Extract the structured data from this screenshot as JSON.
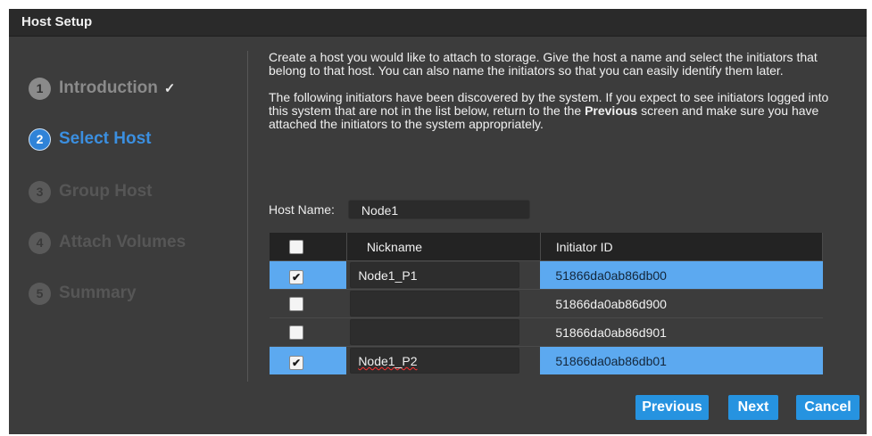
{
  "dialog": {
    "title": "Host Setup"
  },
  "steps": [
    {
      "number": "1",
      "label": "Introduction",
      "state": "done",
      "check": "✓"
    },
    {
      "number": "2",
      "label": "Select Host",
      "state": "active"
    },
    {
      "number": "3",
      "label": "Group Host",
      "state": "pending"
    },
    {
      "number": "4",
      "label": "Attach Volumes",
      "state": "pending"
    },
    {
      "number": "5",
      "label": "Summary",
      "state": "pending"
    }
  ],
  "content": {
    "intro": "Create a host you would like to attach to storage. Give the host a name and select the initiators that belong to that host. You can also name the initiators so that you can easily identify them later.",
    "discovered_prefix": "The following initiators have been discovered by the system. If you expect to see initiators logged into this system that are not in the list below, return to the the ",
    "discovered_bold": "Previous",
    "discovered_suffix": " screen and make sure you have attached the initiators to the system appropriately."
  },
  "host_name": {
    "label": "Host Name:",
    "value": "Node1"
  },
  "table": {
    "columns": {
      "select_all": "",
      "nickname": "Nickname",
      "initiator_id": "Initiator ID"
    },
    "rows": [
      {
        "checked": true,
        "nickname": "Node1_P1",
        "initiator_id": "51866da0ab86db00"
      },
      {
        "checked": false,
        "nickname": "",
        "initiator_id": "51866da0ab86d900"
      },
      {
        "checked": false,
        "nickname": "",
        "initiator_id": "51866da0ab86d901"
      },
      {
        "checked": true,
        "nickname": "Node1_P2",
        "initiator_id": "51866da0ab86db01"
      }
    ]
  },
  "buttons": {
    "previous": "Previous",
    "next": "Next",
    "cancel": "Cancel"
  },
  "colors": {
    "accent": "#2693e0",
    "selected_row": "#5ca9f0",
    "active_step": "#3b8fe0"
  }
}
